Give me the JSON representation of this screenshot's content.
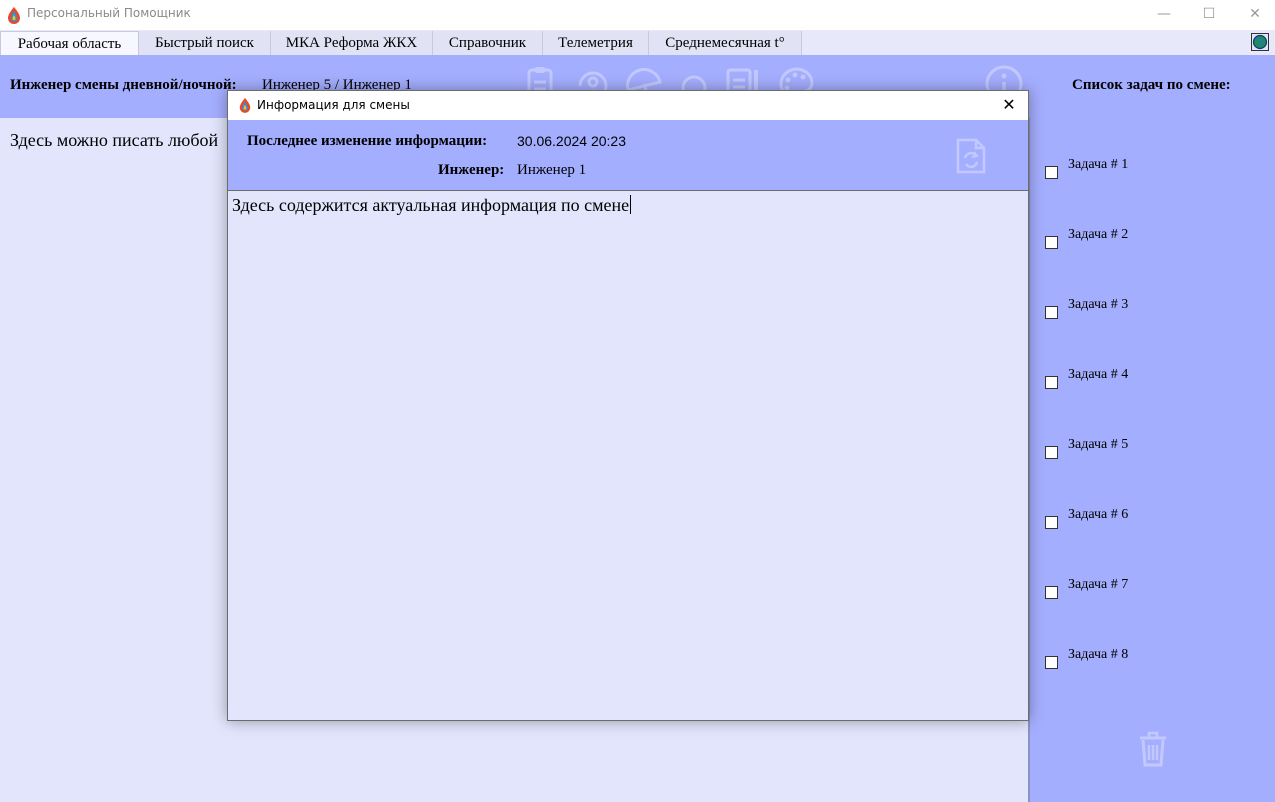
{
  "window": {
    "title": "Персональный Помощник",
    "minimize_glyph": "—",
    "maximize_glyph": "☐",
    "close_glyph": "✕"
  },
  "tabs": [
    {
      "label": "Рабочая область"
    },
    {
      "label": "Быстрый поиск"
    },
    {
      "label": "МКА Реформа ЖКХ"
    },
    {
      "label": "Справочник"
    },
    {
      "label": "Телеметрия"
    },
    {
      "label": "Среднемесячная t°"
    }
  ],
  "toolbar": {
    "engineer_label": "Инженер смены дневной/ночной:",
    "engineer_value": "Инженер 5 / Инженер 1",
    "icons": [
      "clipboard-icon",
      "person-refresh-icon",
      "umbrella-icon",
      "search-icon",
      "notepad-icon",
      "palette-icon",
      "info-icon"
    ]
  },
  "workspace": {
    "text": "Здесь можно писать любой"
  },
  "tasks": {
    "title": "Список задач по смене:",
    "items": [
      {
        "label": "Задача # 1",
        "checked": false
      },
      {
        "label": "Задача # 2",
        "checked": false
      },
      {
        "label": "Задача # 3",
        "checked": false
      },
      {
        "label": "Задача # 4",
        "checked": false
      },
      {
        "label": "Задача # 5",
        "checked": false
      },
      {
        "label": "Задача # 6",
        "checked": false
      },
      {
        "label": "Задача # 7",
        "checked": false
      },
      {
        "label": "Задача # 8",
        "checked": false
      }
    ]
  },
  "dialog": {
    "title": "Информация для смены",
    "close_glyph": "✕",
    "last_modified_label": "Последнее изменение информации:",
    "last_modified_value": "30.06.2024 20:23",
    "engineer_label": "Инженер:",
    "engineer_value": "Инженер 1",
    "body_text": "Здесь содержится актуальная информация по смене"
  },
  "colors": {
    "panel": "#a4aefe",
    "workspace": "#e2e5fc",
    "faded_icon": "#c3c9fe"
  }
}
